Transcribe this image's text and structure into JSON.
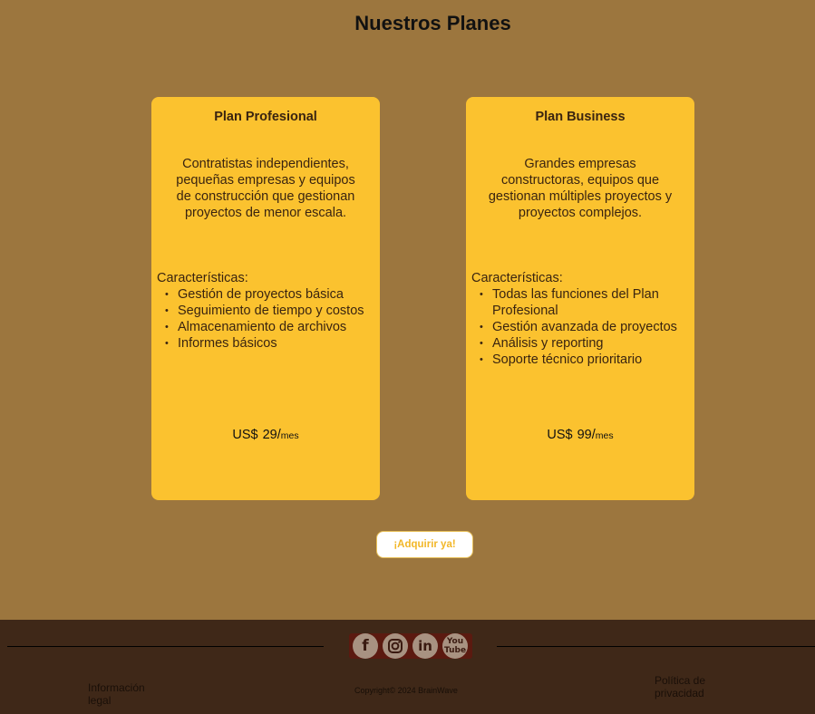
{
  "page": {
    "title": "Nuestros Planes"
  },
  "plans": [
    {
      "name": "Plan Profesional",
      "description": "Contratistas independientes, pequeñas empresas y equipos de construcción que gestionan proyectos de menor escala.",
      "features_label": "Características:",
      "features": [
        "Gestión de proyectos básica",
        "Seguimiento de tiempo y costos",
        "Almacenamiento de archivos",
        "Informes básicos"
      ],
      "price_currency": "US$",
      "price_amount": "29/",
      "price_period": "mes"
    },
    {
      "name": "Plan Business",
      "description": "Grandes empresas constructoras, equipos que gestionan múltiples proyectos y proyectos complejos.",
      "features_label": "Características:",
      "features": [
        "Todas las funciones del Plan Profesional",
        "Gestión avanzada de proyectos",
        "Análisis y reporting",
        "Soporte técnico prioritario"
      ],
      "price_currency": "US$",
      "price_amount": "99/",
      "price_period": "mes"
    }
  ],
  "cta": {
    "label": "¡Adquirir ya!"
  },
  "footer": {
    "social": [
      {
        "icon": "facebook-icon",
        "glyph": "f"
      },
      {
        "icon": "instagram-icon",
        "glyph": ""
      },
      {
        "icon": "linkedin-icon",
        "glyph": "in"
      },
      {
        "icon": "youtube-icon",
        "glyph": "You Tube"
      }
    ],
    "legal_link": "Información legal",
    "copyright": "Copyright© 2024 BrainWave",
    "privacy_link": "Política de privacidad"
  },
  "colors": {
    "background": "#9C763E",
    "card": "#FBC22F",
    "footer": "#3F2818",
    "cta_text": "#F2B728"
  }
}
